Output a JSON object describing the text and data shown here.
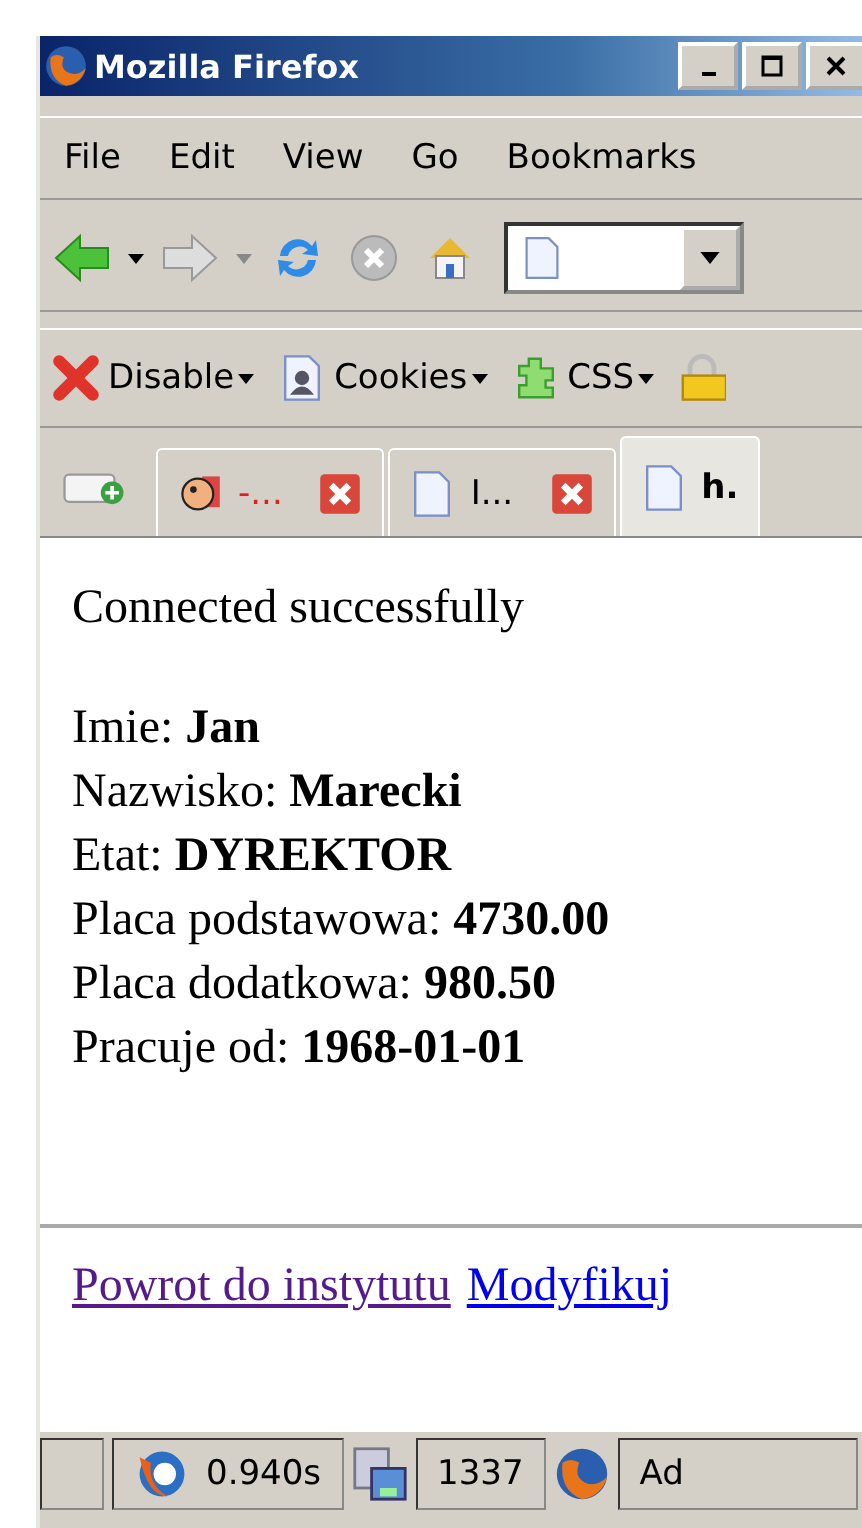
{
  "window": {
    "title": "Mozilla Firefox"
  },
  "menu": [
    "File",
    "Edit",
    "View",
    "Go",
    "Bookmarks"
  ],
  "dev_toolbar": [
    {
      "label": "Disable",
      "kind": "disable"
    },
    {
      "label": "Cookies",
      "kind": "cookies"
    },
    {
      "label": "CSS",
      "kind": "css"
    }
  ],
  "tabs": [
    {
      "label": "-...",
      "kind": "mascot",
      "selected": false
    },
    {
      "label": "I...",
      "kind": "page",
      "selected": false
    },
    {
      "label": "h.",
      "kind": "page",
      "selected": true
    }
  ],
  "content": {
    "message": "Connected successfully",
    "fields": [
      {
        "label": "Imie:",
        "value": "Jan"
      },
      {
        "label": "Nazwisko:",
        "value": "Marecki"
      },
      {
        "label": "Etat:",
        "value": "DYREKTOR"
      },
      {
        "label": "Placa podstawowa:",
        "value": "4730.00"
      },
      {
        "label": "Placa dodatkowa:",
        "value": "980.50"
      },
      {
        "label": "Pracuje od:",
        "value": "1968-01-01"
      }
    ],
    "links": [
      {
        "label": "Powrot do instytutu",
        "visited": true
      },
      {
        "label": "Modyfikuj",
        "visited": false
      }
    ]
  },
  "status_bar": {
    "timer": "0.940s",
    "count": "1337",
    "addon": "Ad"
  }
}
